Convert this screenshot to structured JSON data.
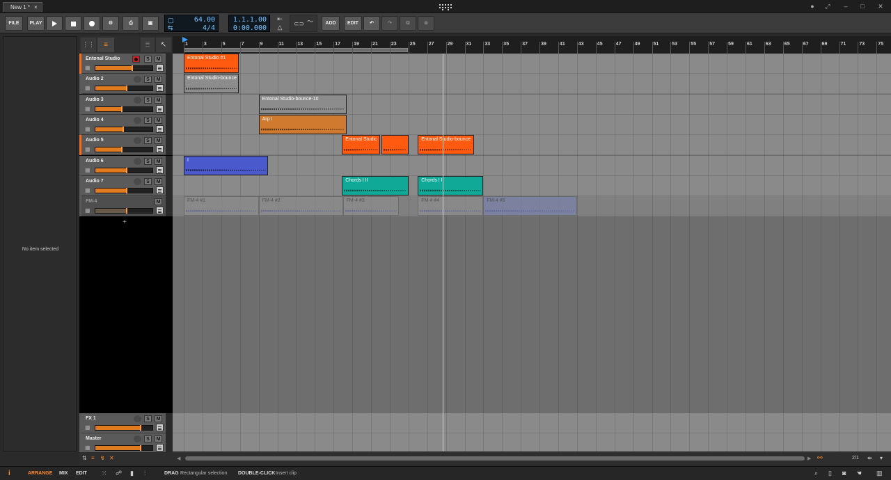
{
  "window": {
    "tab_title": "New 1 *",
    "tab_close": "×"
  },
  "toolbar": {
    "file": "FILE",
    "play": "PLAY",
    "add": "ADD",
    "edit": "EDIT",
    "tempo": "64.00",
    "signature": "4/4",
    "position_bars": "1.1.1.00",
    "position_time": "0:00.000"
  },
  "inspector": {
    "empty_text": "No item selected"
  },
  "ruler_ticks": [
    "1",
    "3",
    "5",
    "7",
    "9",
    "11",
    "13",
    "15",
    "17",
    "19",
    "21",
    "23",
    "25",
    "27",
    "29",
    "31",
    "33",
    "35",
    "37",
    "39",
    "41",
    "43",
    "45",
    "47",
    "49",
    "51",
    "53",
    "55",
    "57",
    "59",
    "61",
    "63",
    "65",
    "67",
    "69",
    "71",
    "73",
    "75"
  ],
  "tracks": [
    {
      "name": "Entonal Studio",
      "solo": "S",
      "mute": "M",
      "accent": "#ff6a1a",
      "volume": 0.64,
      "record_armed": true
    },
    {
      "name": "Audio 2",
      "solo": "S",
      "mute": "M",
      "accent": "#5a5a5a",
      "volume": 0.54
    },
    {
      "name": "Audio 3",
      "solo": "S",
      "mute": "M",
      "accent": "#5a5a5a",
      "volume": 0.45
    },
    {
      "name": "Audio 4",
      "solo": "S",
      "mute": "M",
      "accent": "#5a5a5a",
      "volume": 0.48
    },
    {
      "name": "Audio 5",
      "solo": "S",
      "mute": "M",
      "accent": "#ff6a1a",
      "volume": 0.45
    },
    {
      "name": "Audio 6",
      "solo": "S",
      "mute": "M",
      "accent": "#5a5a5a",
      "volume": 0.54
    },
    {
      "name": "Audio 7",
      "solo": "S",
      "mute": "M",
      "accent": "#5a5a5a",
      "volume": 0.54
    },
    {
      "name": "FM-4",
      "mute": "M",
      "accent": "#5a5a5a",
      "volume": 0.54,
      "dimmed": true
    }
  ],
  "add_track_symbol": "+",
  "fx_tracks": [
    {
      "name": "FX 1",
      "solo": "S",
      "mute": "M",
      "volume": 0.78
    },
    {
      "name": "Master",
      "solo": "S",
      "mute": "M",
      "volume": 0.78
    }
  ],
  "clips": [
    {
      "label": "Entonal Studio #1",
      "lane": 0,
      "start": 1,
      "end": 6.9,
      "color": "#ff5a10"
    },
    {
      "label": "Entonal Studio-bounce",
      "lane": 1,
      "start": 1,
      "end": 6.9,
      "color": "#8c8c8c"
    },
    {
      "label": "Entonal Studio-bounce-10",
      "lane": 2,
      "start": 9,
      "end": 18.4,
      "color": "#8c8c8c"
    },
    {
      "label": "Arp I",
      "lane": 3,
      "start": 9,
      "end": 18.4,
      "color": "#d07a30"
    },
    {
      "label": "Entonal Studic",
      "lane": 4,
      "start": 17.9,
      "end": 22,
      "color": "#ff5a10"
    },
    {
      "label": "",
      "lane": 4,
      "start": 22.1,
      "end": 25,
      "color": "#ff5a10"
    },
    {
      "label": "Entonal Studio-bounce",
      "lane": 4,
      "start": 26,
      "end": 32,
      "color": "#ff5a10"
    },
    {
      "label": "I",
      "lane": 5,
      "start": 1,
      "end": 10,
      "color": "#4a5acc"
    },
    {
      "label": "Chords I II",
      "lane": 6,
      "start": 17.9,
      "end": 25,
      "color": "#10a896"
    },
    {
      "label": "Chords I II",
      "lane": 6,
      "start": 26,
      "end": 33,
      "color": "#10a896"
    },
    {
      "label": "FM-4 #1",
      "lane": 7,
      "start": 1,
      "end": 9,
      "color": "#8c8c8c"
    },
    {
      "label": "FM-4 #2",
      "lane": 7,
      "start": 9,
      "end": 18,
      "color": "#8c8c8c"
    },
    {
      "label": "FM-4 #3",
      "lane": 7,
      "start": 18,
      "end": 24,
      "color": "#8c8c8c"
    },
    {
      "label": "FM-4 #4",
      "lane": 7,
      "start": 26,
      "end": 33,
      "color": "#8c8c8c"
    },
    {
      "label": "FM-4 #5",
      "lane": 7,
      "start": 33,
      "end": 43,
      "color": "#7a82a8"
    }
  ],
  "status": {
    "arrange": "ARRANGE",
    "mix": "MIX",
    "edit": "EDIT",
    "drag_key": "DRAG",
    "drag_desc": "Rectangular selection",
    "dbl_key": "DOUBLE-CLICK",
    "dbl_desc": "Insert clip",
    "zoom": "2/1"
  },
  "colors": {
    "accent_orange": "#ff6a1a",
    "playhead": "#cfcfcf",
    "lcd": "#7cc4ff"
  }
}
